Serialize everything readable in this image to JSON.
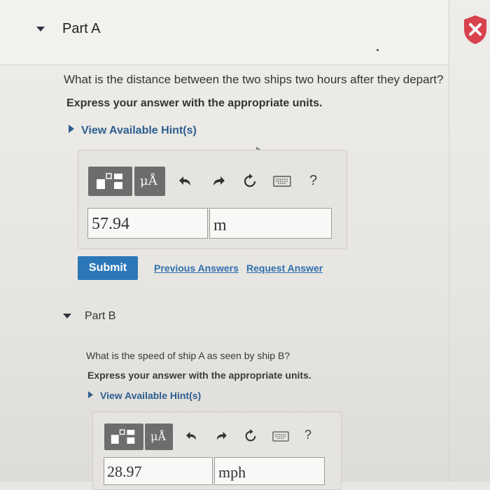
{
  "part_a": {
    "title": "Part A",
    "question": "What is the distance between the two ships two hours after they depart?",
    "instruction": "Express your answer with the appropriate units.",
    "hint_link": "View Available Hint(s)",
    "toolbar": {
      "units_label": "μÅ",
      "help_label": "?"
    },
    "answer": {
      "value": "57.94",
      "units": "m"
    },
    "submit_label": "Submit",
    "previous_answers_label": "Previous Answers",
    "request_answer_label": "Request Answer"
  },
  "part_b": {
    "title": "Part B",
    "question": "What is the speed of ship A as seen by ship B?",
    "instruction": "Express your answer with the appropriate units.",
    "hint_link": "View Available Hint(s)",
    "toolbar": {
      "units_label": "μÅ",
      "help_label": "?"
    },
    "answer": {
      "value": "28.97",
      "units": "mph"
    }
  },
  "colors": {
    "submit": "#2c77b8",
    "link": "#2f6fae",
    "error_badge": "#d8434e",
    "toolbar_button": "#6d6d6d"
  },
  "icons": [
    "caret-down-icon",
    "error-x-icon",
    "template-icon",
    "undo-icon",
    "redo-icon",
    "reset-icon",
    "keyboard-icon",
    "help-icon",
    "hint-triangle-icon"
  ]
}
